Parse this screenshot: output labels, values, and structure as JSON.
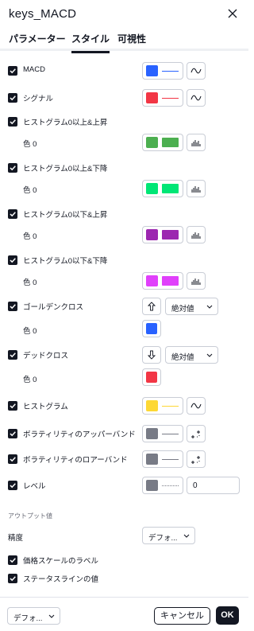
{
  "dialog": {
    "title": "keys_MACD"
  },
  "tabs": [
    {
      "label": "パラメーター",
      "active": false
    },
    {
      "label": "スタイル",
      "active": true
    },
    {
      "label": "可視性",
      "active": false
    }
  ],
  "rows": [
    {
      "label": "MACD",
      "checked": true,
      "color": "#2962ff"
    },
    {
      "label": "シグナル",
      "checked": true,
      "color": "#f23645"
    },
    {
      "label": "ヒストグラム0以上&上昇",
      "checked": true,
      "sublabel": "色 0",
      "color": "#4caf50"
    },
    {
      "label": "ヒストグラム0以上&下降",
      "checked": true,
      "sublabel": "色 0",
      "color": "#00e676"
    },
    {
      "label": "ヒストグラム0以下&上昇",
      "checked": true,
      "sublabel": "色 0",
      "color": "#9c27b0"
    },
    {
      "label": "ヒストグラム0以下&下降",
      "checked": true,
      "sublabel": "色 0",
      "color": "#e040fb"
    },
    {
      "label": "ゴールデンクロス",
      "checked": true,
      "sublabel": "色 0",
      "color": "#2962ff",
      "select": "絶対値"
    },
    {
      "label": "デッドクロス",
      "checked": true,
      "sublabel": "色 0",
      "color": "#f23645",
      "select": "絶対値"
    },
    {
      "label": "ヒストグラム",
      "checked": true,
      "color": "#fdd835"
    },
    {
      "label": "ボラティリティのアッパーバンド",
      "checked": true,
      "color": "#787b86"
    },
    {
      "label": "ボラティリティのロアーバンド",
      "checked": true,
      "color": "#787b86"
    },
    {
      "label": "レベル",
      "checked": true,
      "color": "#787b86",
      "value": "0"
    }
  ],
  "output": {
    "section_label": "アウトプット値",
    "precision_label": "精度",
    "precision_value": "デフォ...",
    "price_scale_label": "価格スケールのラベル",
    "status_line_label": "ステータスラインの値"
  },
  "footer": {
    "template_select": "デフォ...",
    "cancel_label": "キャンセル",
    "ok_label": "OK"
  }
}
